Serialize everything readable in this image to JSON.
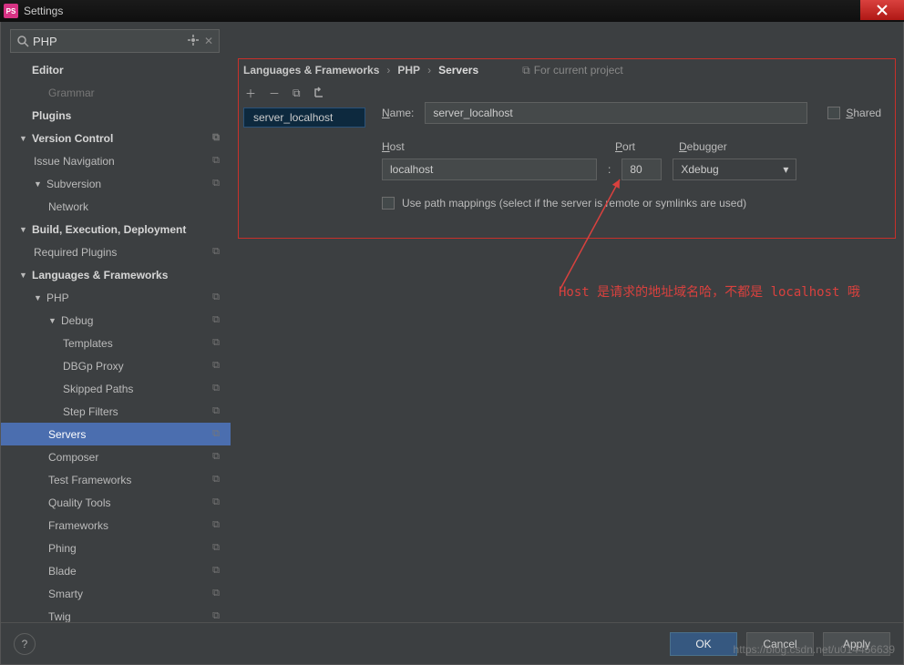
{
  "titlebar": {
    "title": "Settings",
    "app_icon": "PS"
  },
  "search": {
    "value": "PHP"
  },
  "sidebar": {
    "items": [
      {
        "label": "Editor",
        "level": 0,
        "bold": true
      },
      {
        "label": "Grammar",
        "level": 2,
        "dim": true
      },
      {
        "label": "Plugins",
        "level": 0,
        "bold": true
      },
      {
        "label": "Version Control",
        "level": 0,
        "bold": true,
        "arrow": "▼",
        "copy": true
      },
      {
        "label": "Issue Navigation",
        "level": 1,
        "copy": true
      },
      {
        "label": "Subversion",
        "level": 1,
        "arrow": "▼",
        "copy": true
      },
      {
        "label": "Network",
        "level": 2
      },
      {
        "label": "Build, Execution, Deployment",
        "level": 0,
        "bold": true,
        "arrow": "▼"
      },
      {
        "label": "Required Plugins",
        "level": 1,
        "copy": true
      },
      {
        "label": "Languages & Frameworks",
        "level": 0,
        "bold": true,
        "arrow": "▼"
      },
      {
        "label": "PHP",
        "level": 1,
        "arrow": "▼",
        "copy": true
      },
      {
        "label": "Debug",
        "level": 2,
        "arrow": "▼",
        "copy": true
      },
      {
        "label": "Templates",
        "level": 3,
        "copy": true
      },
      {
        "label": "DBGp Proxy",
        "level": 3,
        "copy": true
      },
      {
        "label": "Skipped Paths",
        "level": 3,
        "copy": true
      },
      {
        "label": "Step Filters",
        "level": 3,
        "copy": true
      },
      {
        "label": "Servers",
        "level": 2,
        "copy": true,
        "selected": true,
        "redbox": true
      },
      {
        "label": "Composer",
        "level": 2,
        "copy": true
      },
      {
        "label": "Test Frameworks",
        "level": 2,
        "copy": true
      },
      {
        "label": "Quality Tools",
        "level": 2,
        "copy": true
      },
      {
        "label": "Frameworks",
        "level": 2,
        "copy": true
      },
      {
        "label": "Phing",
        "level": 2,
        "copy": true
      },
      {
        "label": "Blade",
        "level": 2,
        "copy": true
      },
      {
        "label": "Smarty",
        "level": 2,
        "copy": true
      },
      {
        "label": "Twig",
        "level": 2,
        "copy": true
      }
    ]
  },
  "breadcrumb": {
    "part1": "Languages & Frameworks",
    "part2": "PHP",
    "part3": "Servers",
    "project_hint": "For current project"
  },
  "server_list": {
    "selected": "server_localhost"
  },
  "form": {
    "name_label": "Name:",
    "name_value": "server_localhost",
    "shared_label": "Shared",
    "host_label": "Host",
    "host_value": "localhost",
    "port_label": "Port",
    "port_value": "80",
    "port_sep": ":",
    "debugger_label": "Debugger",
    "debugger_value": "Xdebug",
    "mappings_label": "Use path mappings (select if the server is remote or symlinks are used)"
  },
  "annotation": {
    "text": "Host 是请求的地址域名哈，不都是 localhost 哦"
  },
  "footer": {
    "ok": "OK",
    "cancel": "Cancel",
    "apply": "Apply"
  },
  "watermark": "https://blog.csdn.net/u014456639"
}
